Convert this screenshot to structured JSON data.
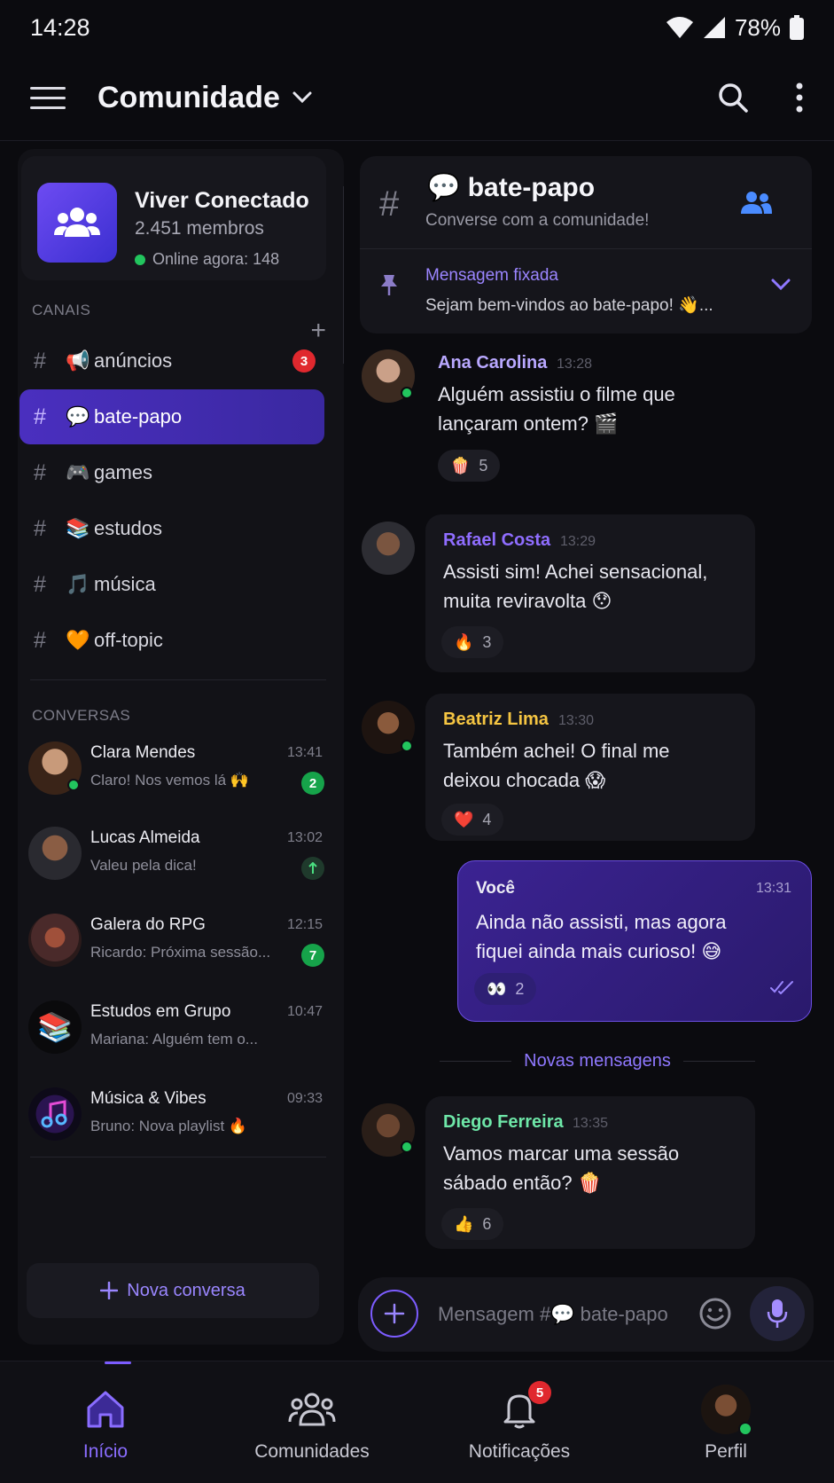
{
  "status": {
    "time": "14:28",
    "battery": "78%"
  },
  "header": {
    "title": "Comunidade"
  },
  "community": {
    "name": "Viver Conectado",
    "members": "2.451 membros",
    "online": "Online agora: 148"
  },
  "channels_section": "CANAIS",
  "channels": [
    {
      "emoji": "📢",
      "label": "anúncios",
      "badge": "3"
    },
    {
      "emoji": "💬",
      "label": "bate-papo",
      "active": true
    },
    {
      "emoji": "🎮",
      "label": "games"
    },
    {
      "emoji": "📚",
      "label": "estudos"
    },
    {
      "emoji": "🎵",
      "label": "música"
    },
    {
      "emoji": "🧡",
      "label": "off-topic"
    }
  ],
  "conversations_section": "CONVERSAS",
  "conversations": [
    {
      "name": "Clara Mendes",
      "time": "13:41",
      "preview": "Claro! Nos vemos lá 🙌",
      "badge": "2",
      "online": true
    },
    {
      "name": "Lucas Almeida",
      "time": "13:02",
      "preview": "Valeu pela dica!",
      "online": true
    },
    {
      "name": "Galera do RPG",
      "time": "12:15",
      "preview": "Ricardo: Próxima sessão...",
      "badge": "7"
    },
    {
      "name": "Estudos em Grupo",
      "time": "10:47",
      "preview": "Mariana: Alguém tem o..."
    },
    {
      "name": "Música & Vibes",
      "time": "09:33",
      "preview": "Bruno: Nova playlist 🔥"
    }
  ],
  "new_conversation": "Nova conversa",
  "channel_header": {
    "title": "💬 bate-papo",
    "subtitle": "Converse com a comunidade!",
    "pinned_title": "Mensagem fixada",
    "pinned_text": "Sejam bem-vindos ao bate-papo! 👋..."
  },
  "messages": [
    {
      "author": "Ana Carolina",
      "time": "13:28",
      "line1": "Alguém assistiu o filme que",
      "line2": "lançaram ontem? 🎬",
      "reaction_emoji": "🍿",
      "reaction_count": "5",
      "name_color": "#b9a8ff"
    },
    {
      "author": "Rafael Costa",
      "time": "13:29",
      "line1": "Assisti sim! Achei sensacional,",
      "line2": "muita reviravolta 😯",
      "reaction_emoji": "🔥",
      "reaction_count": "3",
      "name_color": "#8f6dff"
    },
    {
      "author": "Beatriz Lima",
      "time": "13:30",
      "line1": "Também achei! O final me",
      "line2": "deixou chocada 😱",
      "reaction_emoji": "❤️",
      "reaction_count": "4",
      "name_color": "#f5c542"
    },
    {
      "author": "Você",
      "time": "13:31",
      "line1": "Ainda não assisti, mas agora",
      "line2": "fiquei ainda mais curioso! 😅",
      "reaction_emoji": "👀",
      "reaction_count": "2"
    },
    {
      "author": "Diego Ferreira",
      "time": "13:35",
      "line1": "Vamos marcar uma sessão",
      "line2": "sábado então? 🍿",
      "reaction_emoji": "👍",
      "reaction_count": "6",
      "name_color": "#6ee7a8"
    }
  ],
  "new_messages_label": "Novas mensagens",
  "composer": {
    "placeholder": "Mensagem #💬 bate-papo"
  },
  "bottom_nav": [
    {
      "label": "Início",
      "active": true
    },
    {
      "label": "Comunidades"
    },
    {
      "label": "Notificações",
      "badge": "5"
    },
    {
      "label": "Perfil"
    }
  ],
  "colors": {
    "accent": "#7c5cff",
    "online": "#22c55e",
    "badge": "#e0282e",
    "background": "#0b0b0f"
  }
}
